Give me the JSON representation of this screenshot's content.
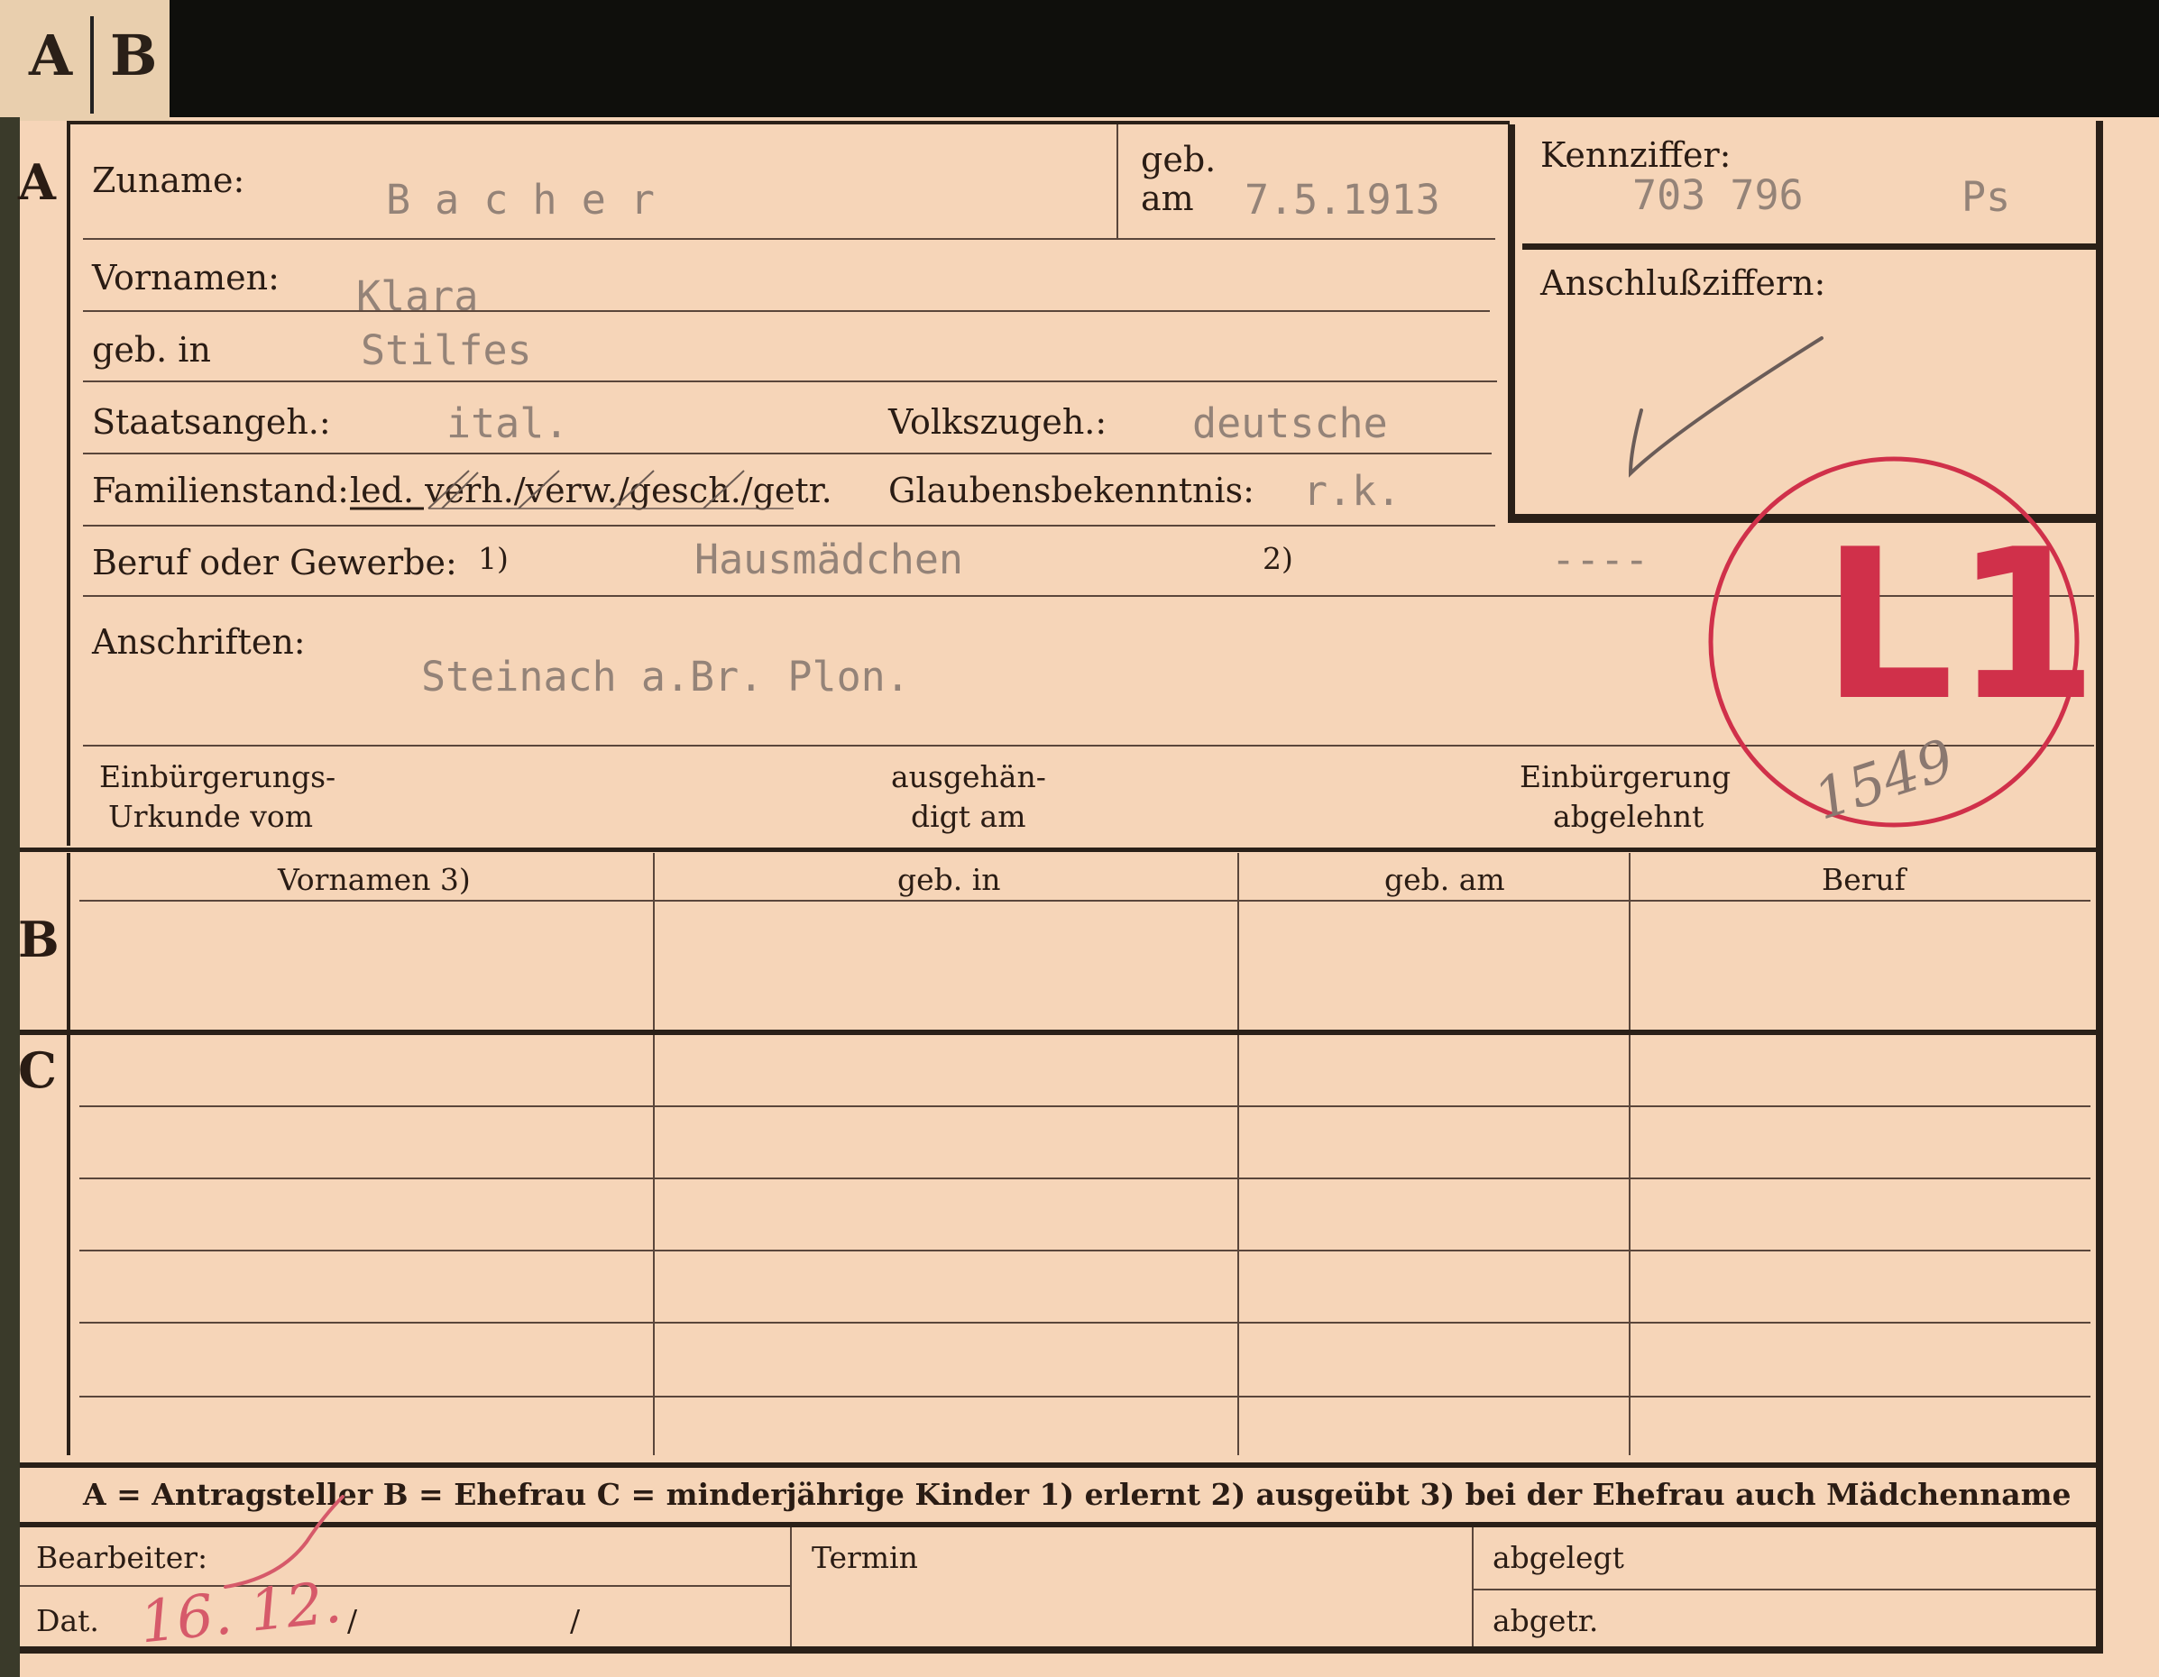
{
  "tabs": {
    "a": "A",
    "b": "B"
  },
  "sections": {
    "a": "A",
    "b": "B",
    "c": "C"
  },
  "applicant": {
    "surname_label": "Zuname:",
    "surname": "B a c h e r",
    "born_label_1": "geb.",
    "born_label_2": "am",
    "born_date": "7.5.1913",
    "given_names_label": "Vornamen:",
    "given_names": "Klara",
    "birthplace_label": "geb. in",
    "birthplace": "Stilfes",
    "citizenship_label": "Staatsangeh.:",
    "citizenship": "ital.",
    "ethnicity_label": "Volkszugeh.:",
    "ethnicity": "deutsche",
    "marital_label": "Familienstand:",
    "marital_options": "led. verh./verw./gesch./getr.",
    "religion_label": "Glaubensbekenntnis:",
    "religion": "r.k.",
    "occupation_label": "Beruf oder Gewerbe:",
    "occupation_note1": "1)",
    "occupation": "Hausmädchen",
    "occupation_note2": "2)",
    "occupation_practiced": "----",
    "address_label": "Anschriften:",
    "address": "Steinach a.Br. Plon.",
    "naturalization_label_1": "Einbürgerungs-",
    "naturalization_label_2": "Urkunde vom",
    "issued_label_1": "ausgehän-",
    "issued_label_2": "digt am",
    "rejected_label_1": "Einbürgerung",
    "rejected_label_2": "abgelehnt"
  },
  "reference": {
    "id_label": "Kennziffer:",
    "id_number": "703 796",
    "id_suffix": "Ps",
    "connection_label": "Anschlußziffern:"
  },
  "stamp": {
    "text": "L1",
    "handwritten": "1549",
    "color": "#d0304a"
  },
  "spouse_table": {
    "headers": [
      "Vornamen 3)",
      "geb. in",
      "geb. am",
      "Beruf"
    ]
  },
  "legend": {
    "text": "A = Antragsteller   B = Ehefrau   C = minderjährige Kinder   1) erlernt   2) ausgeübt   3) bei der Ehefrau auch Mädchenname"
  },
  "footer": {
    "clerk_label": "Bearbeiter:",
    "date_label": "Dat.",
    "date_handwritten": "16. 12.",
    "date_slash_1": "/",
    "date_slash_2": "/",
    "appointment_label": "Termin",
    "filed_label": "abgelegt",
    "separated_label": "abgetr."
  }
}
